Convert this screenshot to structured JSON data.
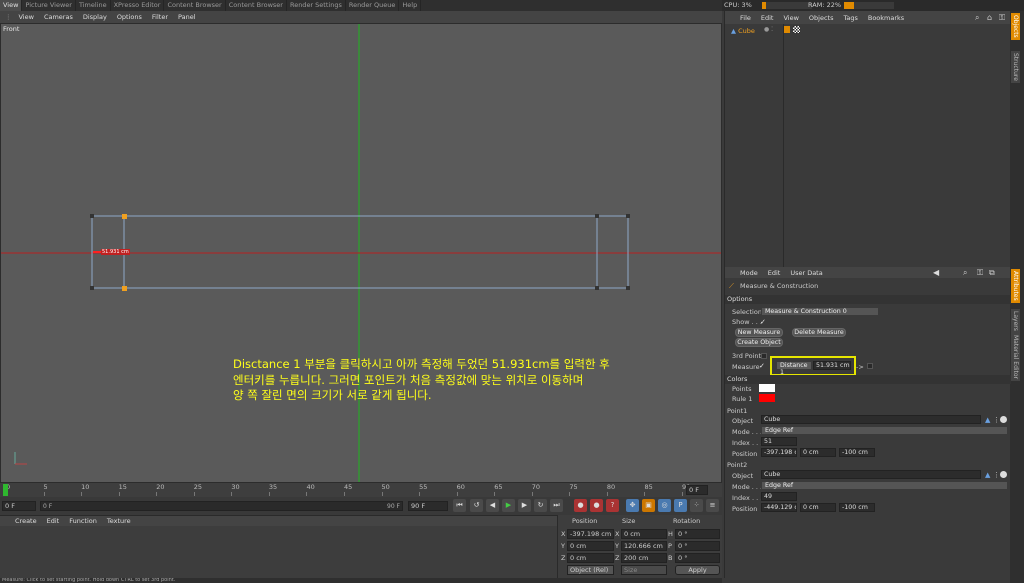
{
  "top_tabs": [
    "View",
    "Picture Viewer",
    "Timeline",
    "XPresso Editor",
    "Content Browser",
    "Content Browser",
    "Render Settings",
    "Render Queue",
    "Help"
  ],
  "perf": {
    "cpu": "CPU: 3%",
    "ram": "RAM: 22%"
  },
  "viewport": {
    "menu": [
      "View",
      "Cameras",
      "Display",
      "Options",
      "Filter",
      "Panel"
    ],
    "label": "Front",
    "measure_tag": "51.931 cm"
  },
  "annotation": [
    "Disctance 1 부분을 클릭하시고 아까 측정해 두었던 51.931cm를 입력한 후",
    "엔터키를 누릅니다. 그러면 포인트가 처음 측정값에 맞는 위치로 이동하며",
    "양 쪽 잘린 면의 크기가 서로 같게 됩니다."
  ],
  "timeline": {
    "ticks": [
      "0",
      "5",
      "10",
      "15",
      "20",
      "25",
      "30",
      "35",
      "40",
      "45",
      "50",
      "55",
      "60",
      "65",
      "70",
      "75",
      "80",
      "85",
      "90"
    ],
    "current_frame": "0 F",
    "start_field": "0 F",
    "slider_left": "0 F",
    "slider_right": "90 F",
    "end_field": "90 F"
  },
  "material": {
    "menu": [
      "Create",
      "Edit",
      "Function",
      "Texture"
    ]
  },
  "coords": {
    "headers": [
      "Position",
      "Size",
      "Rotation"
    ],
    "rows": [
      {
        "axis": "X",
        "pos": "-397.198 cm",
        "saxis": "X",
        "size": "0 cm",
        "raxis": "H",
        "rot": "0 °"
      },
      {
        "axis": "Y",
        "pos": "0 cm",
        "saxis": "Y",
        "size": "120.666 cm",
        "raxis": "P",
        "rot": "0 °"
      },
      {
        "axis": "Z",
        "pos": "0 cm",
        "saxis": "Z",
        "size": "200 cm",
        "raxis": "B",
        "rot": "0 °"
      }
    ],
    "mode": "Object (Rel)",
    "size_mode": "Size",
    "apply": "Apply"
  },
  "status": "Measure: Click to set starting point. Hold down CTRL to set 3rd point.",
  "object_manager": {
    "menu": [
      "File",
      "Edit",
      "View",
      "Objects",
      "Tags",
      "Bookmarks"
    ],
    "object_name": "Cube"
  },
  "right_tabs_top": [
    "Objects",
    "Structure"
  ],
  "right_tabs_bottom": [
    "Attributes",
    "Layers",
    "Material Editor"
  ],
  "attributes": {
    "menu": [
      "Mode",
      "Edit",
      "User Data"
    ],
    "title": "Measure & Construction",
    "options": "Options",
    "selection_label": "Selection",
    "selection_value": "Measure & Construction 0",
    "show_label": "Show . . .",
    "new_measure": "New Measure",
    "delete_measure": "Delete Measure",
    "create_object": "Create Object",
    "third_point": "3rd Point",
    "measure_label": "Measure",
    "distance_label": "Distance 1",
    "distance_value": "51.931 cm",
    "arrow": "->",
    "colors": "Colors",
    "points_label": "Points",
    "rule_label": "Rule 1",
    "point1": {
      "title": "Point1",
      "object_label": "Object",
      "object": "Cube",
      "mode_label": "Mode . . .",
      "mode": "Edge Ref",
      "index_label": "Index . . .",
      "index": "51",
      "position_label": "Position",
      "px": "-397.198 c",
      "py": "0 cm",
      "pz": "-100 cm"
    },
    "point2": {
      "title": "Point2",
      "object_label": "Object",
      "object": "Cube",
      "mode_label": "Mode . . .",
      "mode": "Edge Ref",
      "index_label": "Index . . .",
      "index": "49",
      "position_label": "Position",
      "px": "-449.129 c",
      "py": "0 cm",
      "pz": "-100 cm"
    }
  },
  "colors": {
    "accent": "#e08a00",
    "highlight": "#e6e600",
    "rule": "#ff0000"
  }
}
